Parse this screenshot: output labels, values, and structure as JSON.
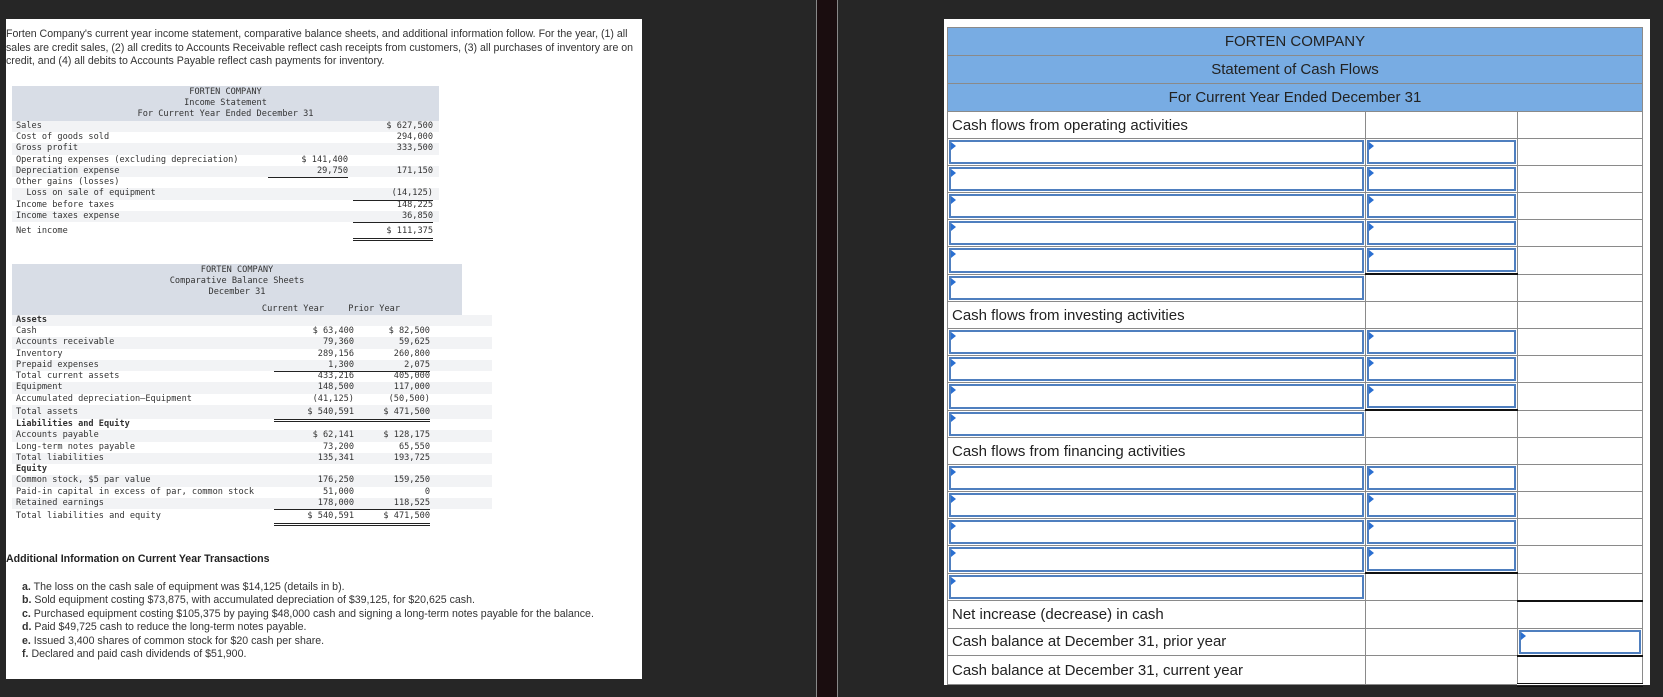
{
  "problem": {
    "intro": "Forten Company's current year income statement, comparative balance sheets, and additional information follow. For the year, (1) all sales are credit sales, (2) all credits to Accounts Receivable reflect cash receipts from customers, (3) all purchases of inventory are on credit, and (4) all debits to Accounts Payable reflect cash payments for inventory.",
    "income_statement": {
      "company": "FORTEN COMPANY",
      "title": "Income Statement",
      "period": "For Current Year Ended December 31",
      "rows": [
        {
          "label": "Sales",
          "c1": "",
          "c2": "$ 627,500"
        },
        {
          "label": "Cost of goods sold",
          "c1": "",
          "c2": "294,000"
        },
        {
          "label": "Gross profit",
          "c1": "",
          "c2": "333,500"
        },
        {
          "label": "Operating expenses (excluding depreciation)",
          "c1": "$ 141,400",
          "c2": ""
        },
        {
          "label": "Depreciation expense",
          "c1": "29,750",
          "c2": "171,150"
        },
        {
          "label": "Other gains (losses)",
          "c1": "",
          "c2": ""
        },
        {
          "label": "  Loss on sale of equipment",
          "c1": "",
          "c2": "(14,125)"
        },
        {
          "label": "Income before taxes",
          "c1": "",
          "c2": "148,225"
        },
        {
          "label": "Income taxes expense",
          "c1": "",
          "c2": "36,850"
        },
        {
          "label": "Net income",
          "c1": "",
          "c2": "$ 111,375"
        }
      ]
    },
    "balance_sheet": {
      "company": "FORTEN COMPANY",
      "title": "Comparative Balance Sheets",
      "period": "December 31",
      "col_current": "Current Year",
      "col_prior": "Prior Year",
      "rows": [
        {
          "label": "Assets",
          "c1": "",
          "c2": "",
          "bold": true
        },
        {
          "label": "Cash",
          "c1": "$ 63,400",
          "c2": "$ 82,500"
        },
        {
          "label": "Accounts receivable",
          "c1": "79,360",
          "c2": "59,625"
        },
        {
          "label": "Inventory",
          "c1": "289,156",
          "c2": "260,800"
        },
        {
          "label": "Prepaid expenses",
          "c1": "1,300",
          "c2": "2,075"
        },
        {
          "label": "Total current assets",
          "c1": "433,216",
          "c2": "405,000"
        },
        {
          "label": "Equipment",
          "c1": "148,500",
          "c2": "117,000"
        },
        {
          "label": "Accumulated depreciation—Equipment",
          "c1": "(41,125)",
          "c2": "(50,500)"
        },
        {
          "label": "Total assets",
          "c1": "$ 540,591",
          "c2": "$ 471,500"
        },
        {
          "label": "Liabilities and Equity",
          "c1": "",
          "c2": "",
          "bold": true
        },
        {
          "label": "Accounts payable",
          "c1": "$ 62,141",
          "c2": "$ 128,175"
        },
        {
          "label": "Long-term notes payable",
          "c1": "73,200",
          "c2": "65,550"
        },
        {
          "label": "Total liabilities",
          "c1": "135,341",
          "c2": "193,725"
        },
        {
          "label": "Equity",
          "c1": "",
          "c2": "",
          "bold": true
        },
        {
          "label": "Common stock, $5 par value",
          "c1": "176,250",
          "c2": "159,250"
        },
        {
          "label": "Paid-in capital in excess of par, common stock",
          "c1": "51,000",
          "c2": "0"
        },
        {
          "label": "Retained earnings",
          "c1": "178,000",
          "c2": "118,525"
        },
        {
          "label": "Total liabilities and equity",
          "c1": "$ 540,591",
          "c2": "$ 471,500"
        }
      ]
    },
    "additional_title": "Additional Information on Current Year Transactions",
    "additional": [
      {
        "key": "a.",
        "text": "The loss on the cash sale of equipment was $14,125 (details in b)."
      },
      {
        "key": "b.",
        "text": "Sold equipment costing $73,875, with accumulated depreciation of $39,125, for $20,625 cash."
      },
      {
        "key": "c.",
        "text": "Purchased equipment costing $105,375 by paying $48,000 cash and signing a long-term notes payable for the balance."
      },
      {
        "key": "d.",
        "text": "Paid $49,725 cash to reduce the long-term notes payable."
      },
      {
        "key": "e.",
        "text": "Issued 3,400 shares of common stock for $20 cash per share."
      },
      {
        "key": "f.",
        "text": "Declared and paid cash dividends of $51,900."
      }
    ]
  },
  "answer": {
    "company": "FORTEN COMPANY",
    "title": "Statement of Cash Flows",
    "period": "For Current Year Ended December 31",
    "operating_label": "Cash flows from operating activities",
    "investing_label": "Cash flows from investing activities",
    "financing_label": "Cash flows from financing activities",
    "net_change_label": "Net increase (decrease) in cash",
    "prior_balance_label": "Cash balance at December 31, prior year",
    "current_balance_label": "Cash balance at December 31, current year",
    "inputs_value": ""
  },
  "colors": {
    "header_blue": "#78ace3",
    "input_border": "#4f7fbf",
    "statement_header_gray": "#d8dde6"
  }
}
